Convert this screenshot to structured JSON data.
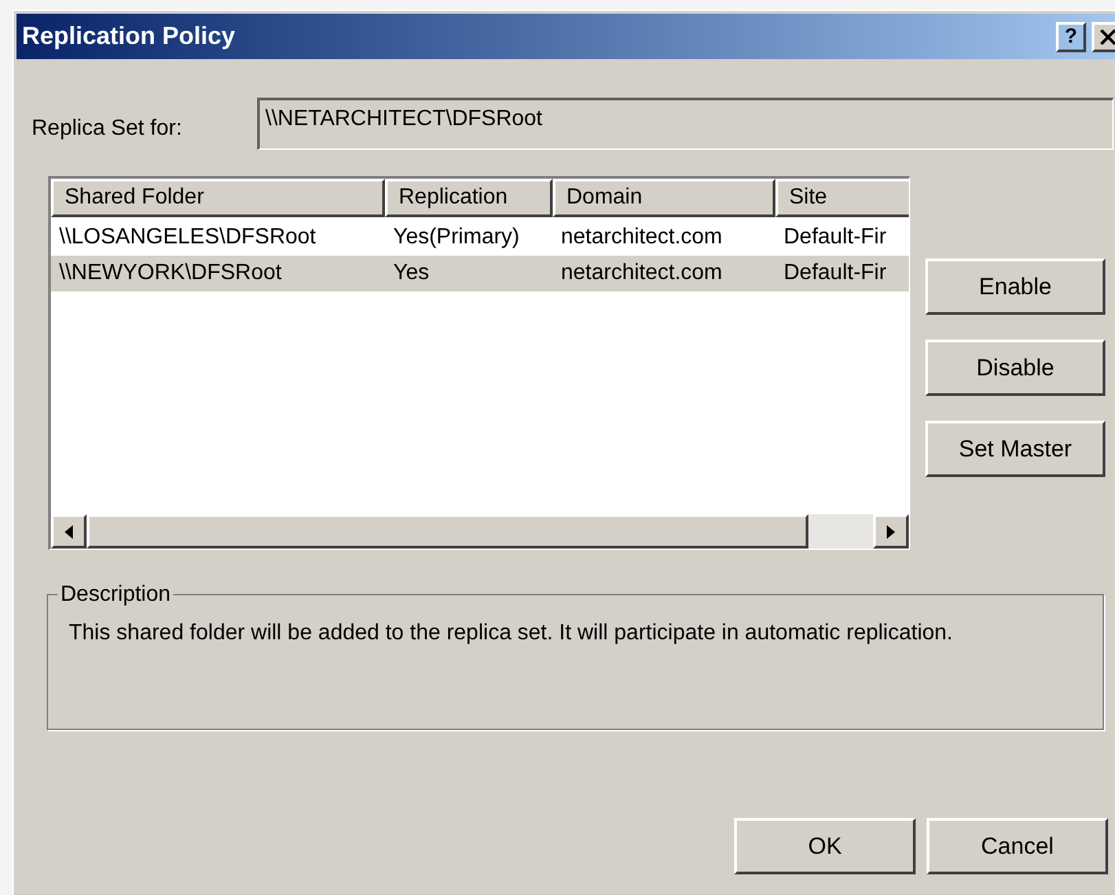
{
  "window": {
    "title": "Replication Policy",
    "title_buttons": [
      "?"
    ]
  },
  "replica_set": {
    "label": "Replica Set for:",
    "value": "\\\\NETARCHITECT\\DFSRoot"
  },
  "table": {
    "columns": [
      "Shared Folder",
      "Replication",
      "Domain",
      "Site"
    ],
    "rows": [
      {
        "cells": [
          "\\\\LOSANGELES\\DFSRoot",
          "Yes(Primary)",
          "netarchitect.com",
          "Default-Fir"
        ],
        "selected": false
      },
      {
        "cells": [
          "\\\\NEWYORK\\DFSRoot",
          "Yes",
          "netarchitect.com",
          "Default-Fir"
        ],
        "selected": true
      }
    ]
  },
  "side_buttons": [
    "Enable",
    "Disable",
    "Set Master"
  ],
  "description": {
    "title": "Description",
    "text": "This shared folder will be added to the replica set. It will participate in automatic replication."
  },
  "buttons": [
    "OK",
    "Cancel"
  ]
}
